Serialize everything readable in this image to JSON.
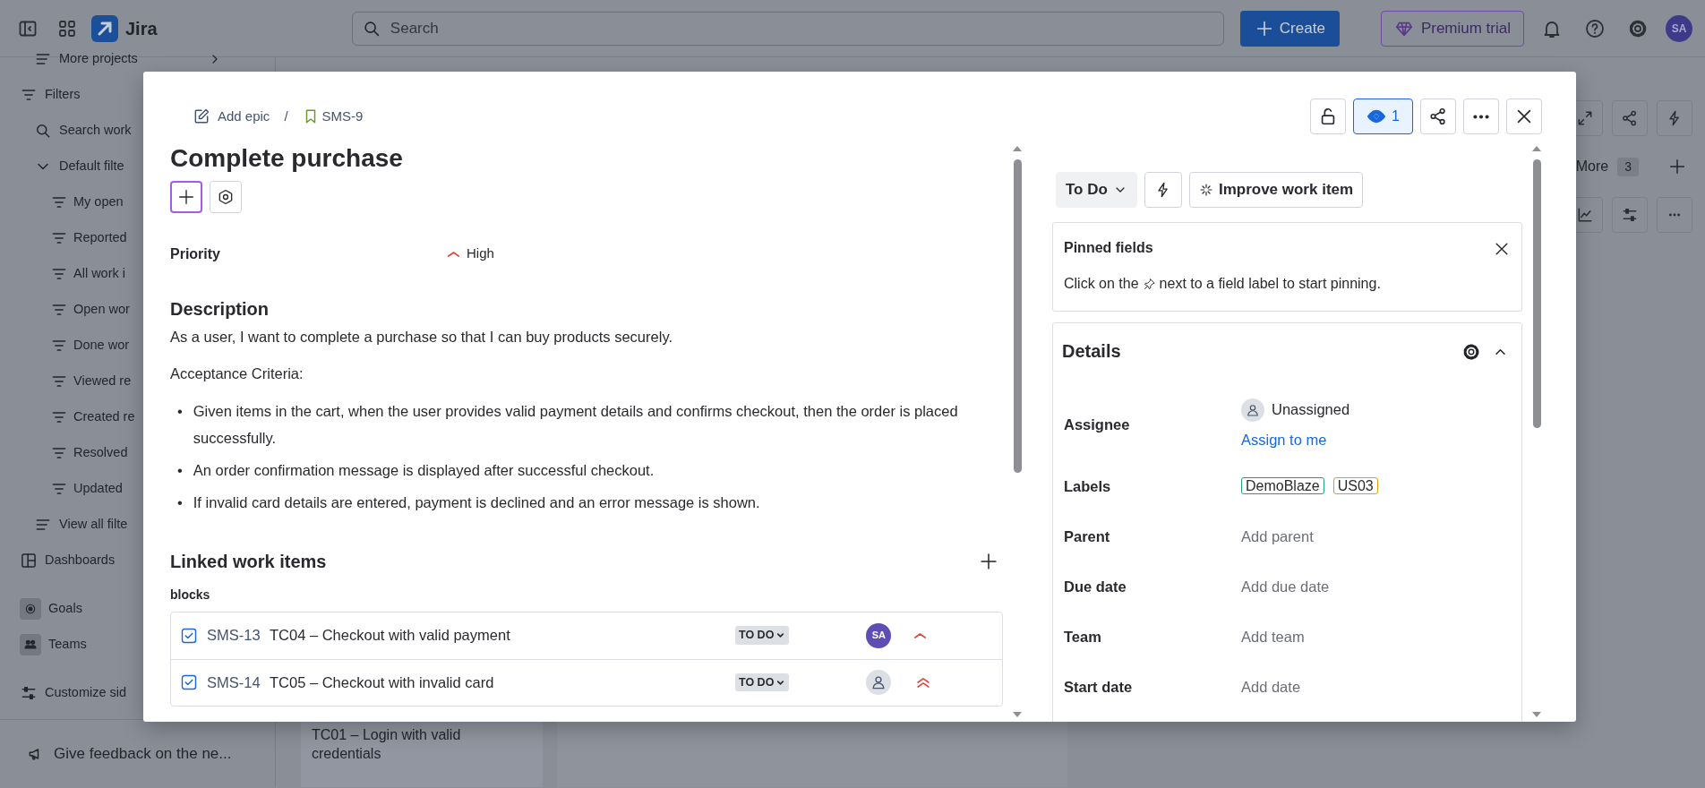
{
  "topbar": {
    "product": "Jira",
    "search": {
      "placeholder": "Search"
    },
    "create": "Create",
    "premium": "Premium trial",
    "avatar": "SA"
  },
  "sidebar": {
    "items": [
      {
        "kind": "projects",
        "label": "More projects"
      },
      {
        "kind": "filters",
        "label": "Filters"
      },
      {
        "kind": "search",
        "label": "Search work"
      },
      {
        "kind": "folder",
        "label": "Default filte",
        "expanded": true,
        "children": [
          {
            "kind": "filter",
            "label": "My open"
          },
          {
            "kind": "filter",
            "label": "Reported"
          },
          {
            "kind": "filter",
            "label": "All work i"
          },
          {
            "kind": "filter",
            "label": "Open wor"
          },
          {
            "kind": "filter",
            "label": "Done wor"
          },
          {
            "kind": "filter",
            "label": "Viewed re"
          },
          {
            "kind": "filter",
            "label": "Created re"
          },
          {
            "kind": "filter",
            "label": "Resolved"
          },
          {
            "kind": "filter",
            "label": "Updated"
          }
        ]
      },
      {
        "kind": "all-filters",
        "label": "View all filte"
      },
      {
        "kind": "dashboards",
        "label": "Dashboards"
      },
      {
        "kind": "goals",
        "label": "Goals"
      },
      {
        "kind": "teams",
        "label": "Teams"
      },
      {
        "kind": "customize",
        "label": "Customize sid"
      }
    ],
    "feedback": "Give feedback on the ne..."
  },
  "board": {
    "card": "TC01 – Login with valid credentials",
    "more": "More",
    "more_count": "3"
  },
  "modal": {
    "breadcrumb": {
      "epic": "Add epic",
      "separator": "/",
      "key": "SMS-9"
    },
    "watchers": {
      "count": "1",
      "watching": true
    },
    "title": "Complete purchase",
    "priority": {
      "label": "Priority",
      "value": "High",
      "kind": "high"
    },
    "description": {
      "heading": "Description",
      "text": "As a user, I want to complete a purchase so that I can buy products securely.",
      "criteria": "Acceptance Criteria:",
      "bullet": "•",
      "bullets": [
        "Given items in the cart, when the user provides valid payment details and confirms checkout, then the order is placed successfully.",
        "An order confirmation message is displayed after successful checkout.",
        "If invalid card details are entered, payment is declined and an error message is shown."
      ]
    },
    "linked": {
      "heading": "Linked work items",
      "relation": "blocks",
      "items": [
        {
          "key": "SMS-13",
          "summary": "TC04 – Checkout with valid payment",
          "status": "TO DO",
          "assignee": "SA",
          "kind": "high"
        },
        {
          "key": "SMS-14",
          "summary": "TC05 – Checkout with invalid card",
          "status": "TO DO",
          "kind": "highest"
        }
      ]
    },
    "status": "To Do",
    "improve": "Improve work item",
    "pinned": {
      "title": "Pinned fields",
      "hint_before": "Click on the",
      "hint_after": "next to a field label to start pinning."
    },
    "details": {
      "title": "Details",
      "expanded": true,
      "fields": [
        {
          "kind": "assignee",
          "label": "Assignee",
          "value": "Unassigned",
          "action": "Assign to me"
        },
        {
          "kind": "labels",
          "label": "Labels",
          "tags": [
            {
              "text": "DemoBlaze",
              "color": "#22a06b"
            },
            {
              "text": "US03",
              "color": "#d9a400"
            }
          ]
        },
        {
          "kind": "empty",
          "label": "Parent",
          "value": "Add parent"
        },
        {
          "kind": "empty",
          "label": "Due date",
          "value": "Add due date"
        },
        {
          "kind": "empty",
          "label": "Team",
          "value": "Add team"
        },
        {
          "kind": "empty",
          "label": "Start date",
          "value": "Add date"
        }
      ]
    }
  }
}
